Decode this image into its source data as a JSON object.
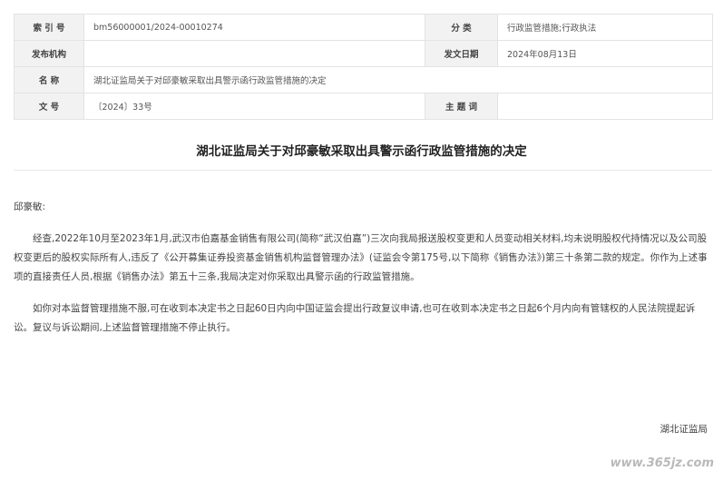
{
  "metadata": {
    "index_label": "索 引 号",
    "index_value": "bm56000001/2024-00010274",
    "category_label": "分 类",
    "category_value": "行政监管措施;行政执法",
    "issuer_label": "发布机构",
    "issuer_value": "",
    "date_label": "发文日期",
    "date_value": "2024年08月13日",
    "name_label": "名 称",
    "name_value": "湖北证监局关于对邱豪敏采取出具警示函行政监管措施的决定",
    "docno_label": "文 号",
    "docno_value": "〔2024〕33号",
    "subject_label": "主 题 词",
    "subject_value": ""
  },
  "document": {
    "title": "湖北证监局关于对邱豪敏采取出具警示函行政监管措施的决定",
    "salutation": "邱豪敏:",
    "paragraphs": [
      "经查,2022年10月至2023年1月,武汉市伯嘉基金销售有限公司(简称“武汉伯嘉”)三次向我局报送股权变更和人员变动相关材料,均未说明股权代持情况以及公司股权变更后的股权实际所有人,违反了《公开募集证券投资基金销售机构监督管理办法》(证监会令第175号,以下简称《销售办法》)第三十条第二款的规定。你作为上述事项的直接责任人员,根据《销售办法》第五十三条,我局决定对你采取出具警示函的行政监管措施。",
      "如你对本监督管理措施不服,可在收到本决定书之日起60日内向中国证监会提出行政复议申请,也可在收到本决定书之日起6个月内向有管辖权的人民法院提起诉讼。复议与诉讼期间,上述监督管理措施不停止执行。"
    ],
    "signature": "湖北证监局"
  },
  "watermark": "www.365jz.com"
}
